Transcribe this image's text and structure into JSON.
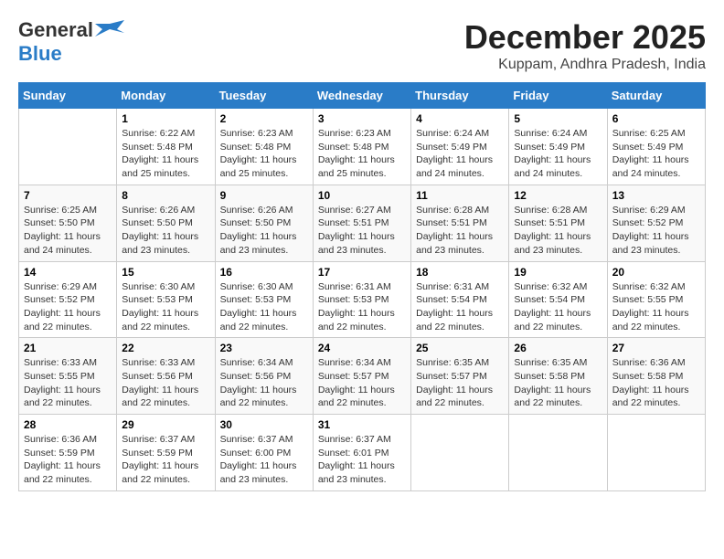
{
  "logo": {
    "line1": "General",
    "line2": "Blue",
    "icon": "▶"
  },
  "title": "December 2025",
  "subtitle": "Kuppam, Andhra Pradesh, India",
  "days_of_week": [
    "Sunday",
    "Monday",
    "Tuesday",
    "Wednesday",
    "Thursday",
    "Friday",
    "Saturday"
  ],
  "weeks": [
    [
      {
        "day": "",
        "info": ""
      },
      {
        "day": "1",
        "info": "Sunrise: 6:22 AM\nSunset: 5:48 PM\nDaylight: 11 hours\nand 25 minutes."
      },
      {
        "day": "2",
        "info": "Sunrise: 6:23 AM\nSunset: 5:48 PM\nDaylight: 11 hours\nand 25 minutes."
      },
      {
        "day": "3",
        "info": "Sunrise: 6:23 AM\nSunset: 5:48 PM\nDaylight: 11 hours\nand 25 minutes."
      },
      {
        "day": "4",
        "info": "Sunrise: 6:24 AM\nSunset: 5:49 PM\nDaylight: 11 hours\nand 24 minutes."
      },
      {
        "day": "5",
        "info": "Sunrise: 6:24 AM\nSunset: 5:49 PM\nDaylight: 11 hours\nand 24 minutes."
      },
      {
        "day": "6",
        "info": "Sunrise: 6:25 AM\nSunset: 5:49 PM\nDaylight: 11 hours\nand 24 minutes."
      }
    ],
    [
      {
        "day": "7",
        "info": "Sunrise: 6:25 AM\nSunset: 5:50 PM\nDaylight: 11 hours\nand 24 minutes."
      },
      {
        "day": "8",
        "info": "Sunrise: 6:26 AM\nSunset: 5:50 PM\nDaylight: 11 hours\nand 23 minutes."
      },
      {
        "day": "9",
        "info": "Sunrise: 6:26 AM\nSunset: 5:50 PM\nDaylight: 11 hours\nand 23 minutes."
      },
      {
        "day": "10",
        "info": "Sunrise: 6:27 AM\nSunset: 5:51 PM\nDaylight: 11 hours\nand 23 minutes."
      },
      {
        "day": "11",
        "info": "Sunrise: 6:28 AM\nSunset: 5:51 PM\nDaylight: 11 hours\nand 23 minutes."
      },
      {
        "day": "12",
        "info": "Sunrise: 6:28 AM\nSunset: 5:51 PM\nDaylight: 11 hours\nand 23 minutes."
      },
      {
        "day": "13",
        "info": "Sunrise: 6:29 AM\nSunset: 5:52 PM\nDaylight: 11 hours\nand 23 minutes."
      }
    ],
    [
      {
        "day": "14",
        "info": "Sunrise: 6:29 AM\nSunset: 5:52 PM\nDaylight: 11 hours\nand 22 minutes."
      },
      {
        "day": "15",
        "info": "Sunrise: 6:30 AM\nSunset: 5:53 PM\nDaylight: 11 hours\nand 22 minutes."
      },
      {
        "day": "16",
        "info": "Sunrise: 6:30 AM\nSunset: 5:53 PM\nDaylight: 11 hours\nand 22 minutes."
      },
      {
        "day": "17",
        "info": "Sunrise: 6:31 AM\nSunset: 5:53 PM\nDaylight: 11 hours\nand 22 minutes."
      },
      {
        "day": "18",
        "info": "Sunrise: 6:31 AM\nSunset: 5:54 PM\nDaylight: 11 hours\nand 22 minutes."
      },
      {
        "day": "19",
        "info": "Sunrise: 6:32 AM\nSunset: 5:54 PM\nDaylight: 11 hours\nand 22 minutes."
      },
      {
        "day": "20",
        "info": "Sunrise: 6:32 AM\nSunset: 5:55 PM\nDaylight: 11 hours\nand 22 minutes."
      }
    ],
    [
      {
        "day": "21",
        "info": "Sunrise: 6:33 AM\nSunset: 5:55 PM\nDaylight: 11 hours\nand 22 minutes."
      },
      {
        "day": "22",
        "info": "Sunrise: 6:33 AM\nSunset: 5:56 PM\nDaylight: 11 hours\nand 22 minutes."
      },
      {
        "day": "23",
        "info": "Sunrise: 6:34 AM\nSunset: 5:56 PM\nDaylight: 11 hours\nand 22 minutes."
      },
      {
        "day": "24",
        "info": "Sunrise: 6:34 AM\nSunset: 5:57 PM\nDaylight: 11 hours\nand 22 minutes."
      },
      {
        "day": "25",
        "info": "Sunrise: 6:35 AM\nSunset: 5:57 PM\nDaylight: 11 hours\nand 22 minutes."
      },
      {
        "day": "26",
        "info": "Sunrise: 6:35 AM\nSunset: 5:58 PM\nDaylight: 11 hours\nand 22 minutes."
      },
      {
        "day": "27",
        "info": "Sunrise: 6:36 AM\nSunset: 5:58 PM\nDaylight: 11 hours\nand 22 minutes."
      }
    ],
    [
      {
        "day": "28",
        "info": "Sunrise: 6:36 AM\nSunset: 5:59 PM\nDaylight: 11 hours\nand 22 minutes."
      },
      {
        "day": "29",
        "info": "Sunrise: 6:37 AM\nSunset: 5:59 PM\nDaylight: 11 hours\nand 22 minutes."
      },
      {
        "day": "30",
        "info": "Sunrise: 6:37 AM\nSunset: 6:00 PM\nDaylight: 11 hours\nand 23 minutes."
      },
      {
        "day": "31",
        "info": "Sunrise: 6:37 AM\nSunset: 6:01 PM\nDaylight: 11 hours\nand 23 minutes."
      },
      {
        "day": "",
        "info": ""
      },
      {
        "day": "",
        "info": ""
      },
      {
        "day": "",
        "info": ""
      }
    ]
  ]
}
